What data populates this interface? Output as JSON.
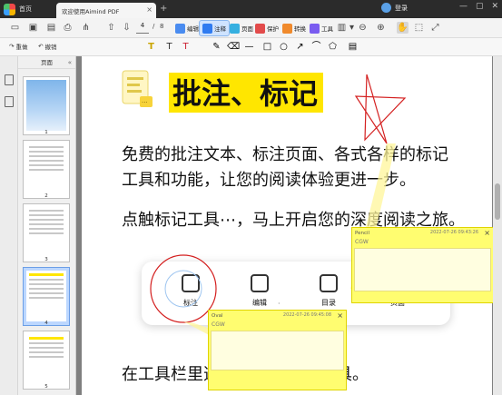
{
  "titlebar": {
    "home_label": "首页",
    "doc_tab_label": "欢迎使用Aimind PDF",
    "close_glyph": "×",
    "add_glyph": "+",
    "user_label": "登录",
    "window_controls": [
      "—",
      "▢",
      "✕"
    ]
  },
  "toolbar1": {
    "page_current": "4",
    "page_sep": "/",
    "page_total": "8",
    "modes": [
      {
        "label": "编辑",
        "color": "#4a8cf0"
      },
      {
        "label": "注释",
        "color": "#2f7bf0"
      },
      {
        "label": "页面",
        "color": "#36b0e0"
      },
      {
        "label": "保护",
        "color": "#e24b4b"
      },
      {
        "label": "转换",
        "color": "#f08a2c"
      },
      {
        "label": "工具",
        "color": "#7a5cf0"
      }
    ],
    "zoom_glyph": "▾"
  },
  "toolbar2": {
    "undo_label": "撤销",
    "redo_label": "重做"
  },
  "thumbnails": {
    "header": "页面",
    "collapse_glyph": "«",
    "pages": [
      "1",
      "2",
      "3",
      "4",
      "5"
    ]
  },
  "document": {
    "title": "批注、标记",
    "para1_line1": "免费的批注文本、标注页面、各式各样的标记",
    "para1_line2": "工具和功能，让您的阅读体验更进一步。",
    "para2": "点触标记工具⋯，马上开启您的深度阅读之旅。",
    "para3_left": "在工具栏里选",
    "para3_right": "工具。",
    "card": {
      "items": [
        {
          "label": "标注"
        },
        {
          "label": "编辑"
        },
        {
          "label": "目录"
        },
        {
          "label": "页面"
        }
      ],
      "dot": "·"
    }
  },
  "stickies": {
    "pencil": {
      "type": "Pencil",
      "date": "2022-07-26 09:43:26",
      "author": "CGW",
      "close": "×"
    },
    "oval": {
      "type": "Oval",
      "date": "2022-07-26 09:45:08",
      "author": "CGW",
      "close": "×"
    }
  },
  "colors": {
    "highlight": "#ffe600",
    "ink_red": "#d42020",
    "sticky_yellow": "#fffd70",
    "accent_blue": "#2f7bf0"
  }
}
